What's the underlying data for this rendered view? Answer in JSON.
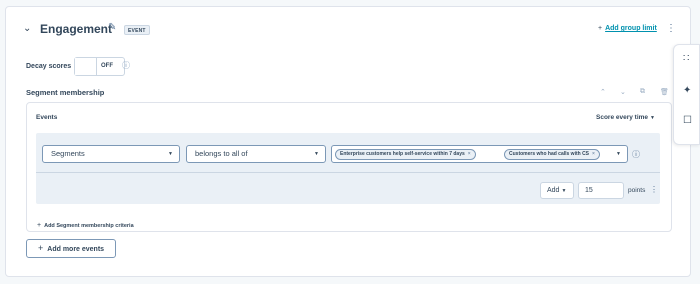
{
  "group": {
    "title": "Engagement",
    "tag": "EVENT",
    "add_group_limit": "Add group limit"
  },
  "decay": {
    "label": "Decay scores",
    "state": "OFF"
  },
  "segment": {
    "title": "Segment membership",
    "events_label": "Events",
    "score_every": "Score every time",
    "criteria": {
      "type": "Segments",
      "operator": "belongs to all of",
      "chips": [
        "Enterprise customers help self-service within 7 days",
        "Customers who had calls with CS"
      ],
      "action": "Add",
      "points": "15",
      "points_label": "points"
    },
    "add_criteria": "Add Segment membership criteria"
  },
  "add_more_events": "Add more events",
  "colors": {
    "accent": "#0091ae",
    "text": "#33475b",
    "criteria_bg": "#eaf0f6"
  },
  "icons": [
    "chevron-down-icon",
    "pencil-icon",
    "plus-icon",
    "kebab-icon",
    "info-icon",
    "chevron-up-icon",
    "copy-icon",
    "trash-icon",
    "grid-icon",
    "sparkle-icon",
    "feedback-icon",
    "close-icon"
  ]
}
